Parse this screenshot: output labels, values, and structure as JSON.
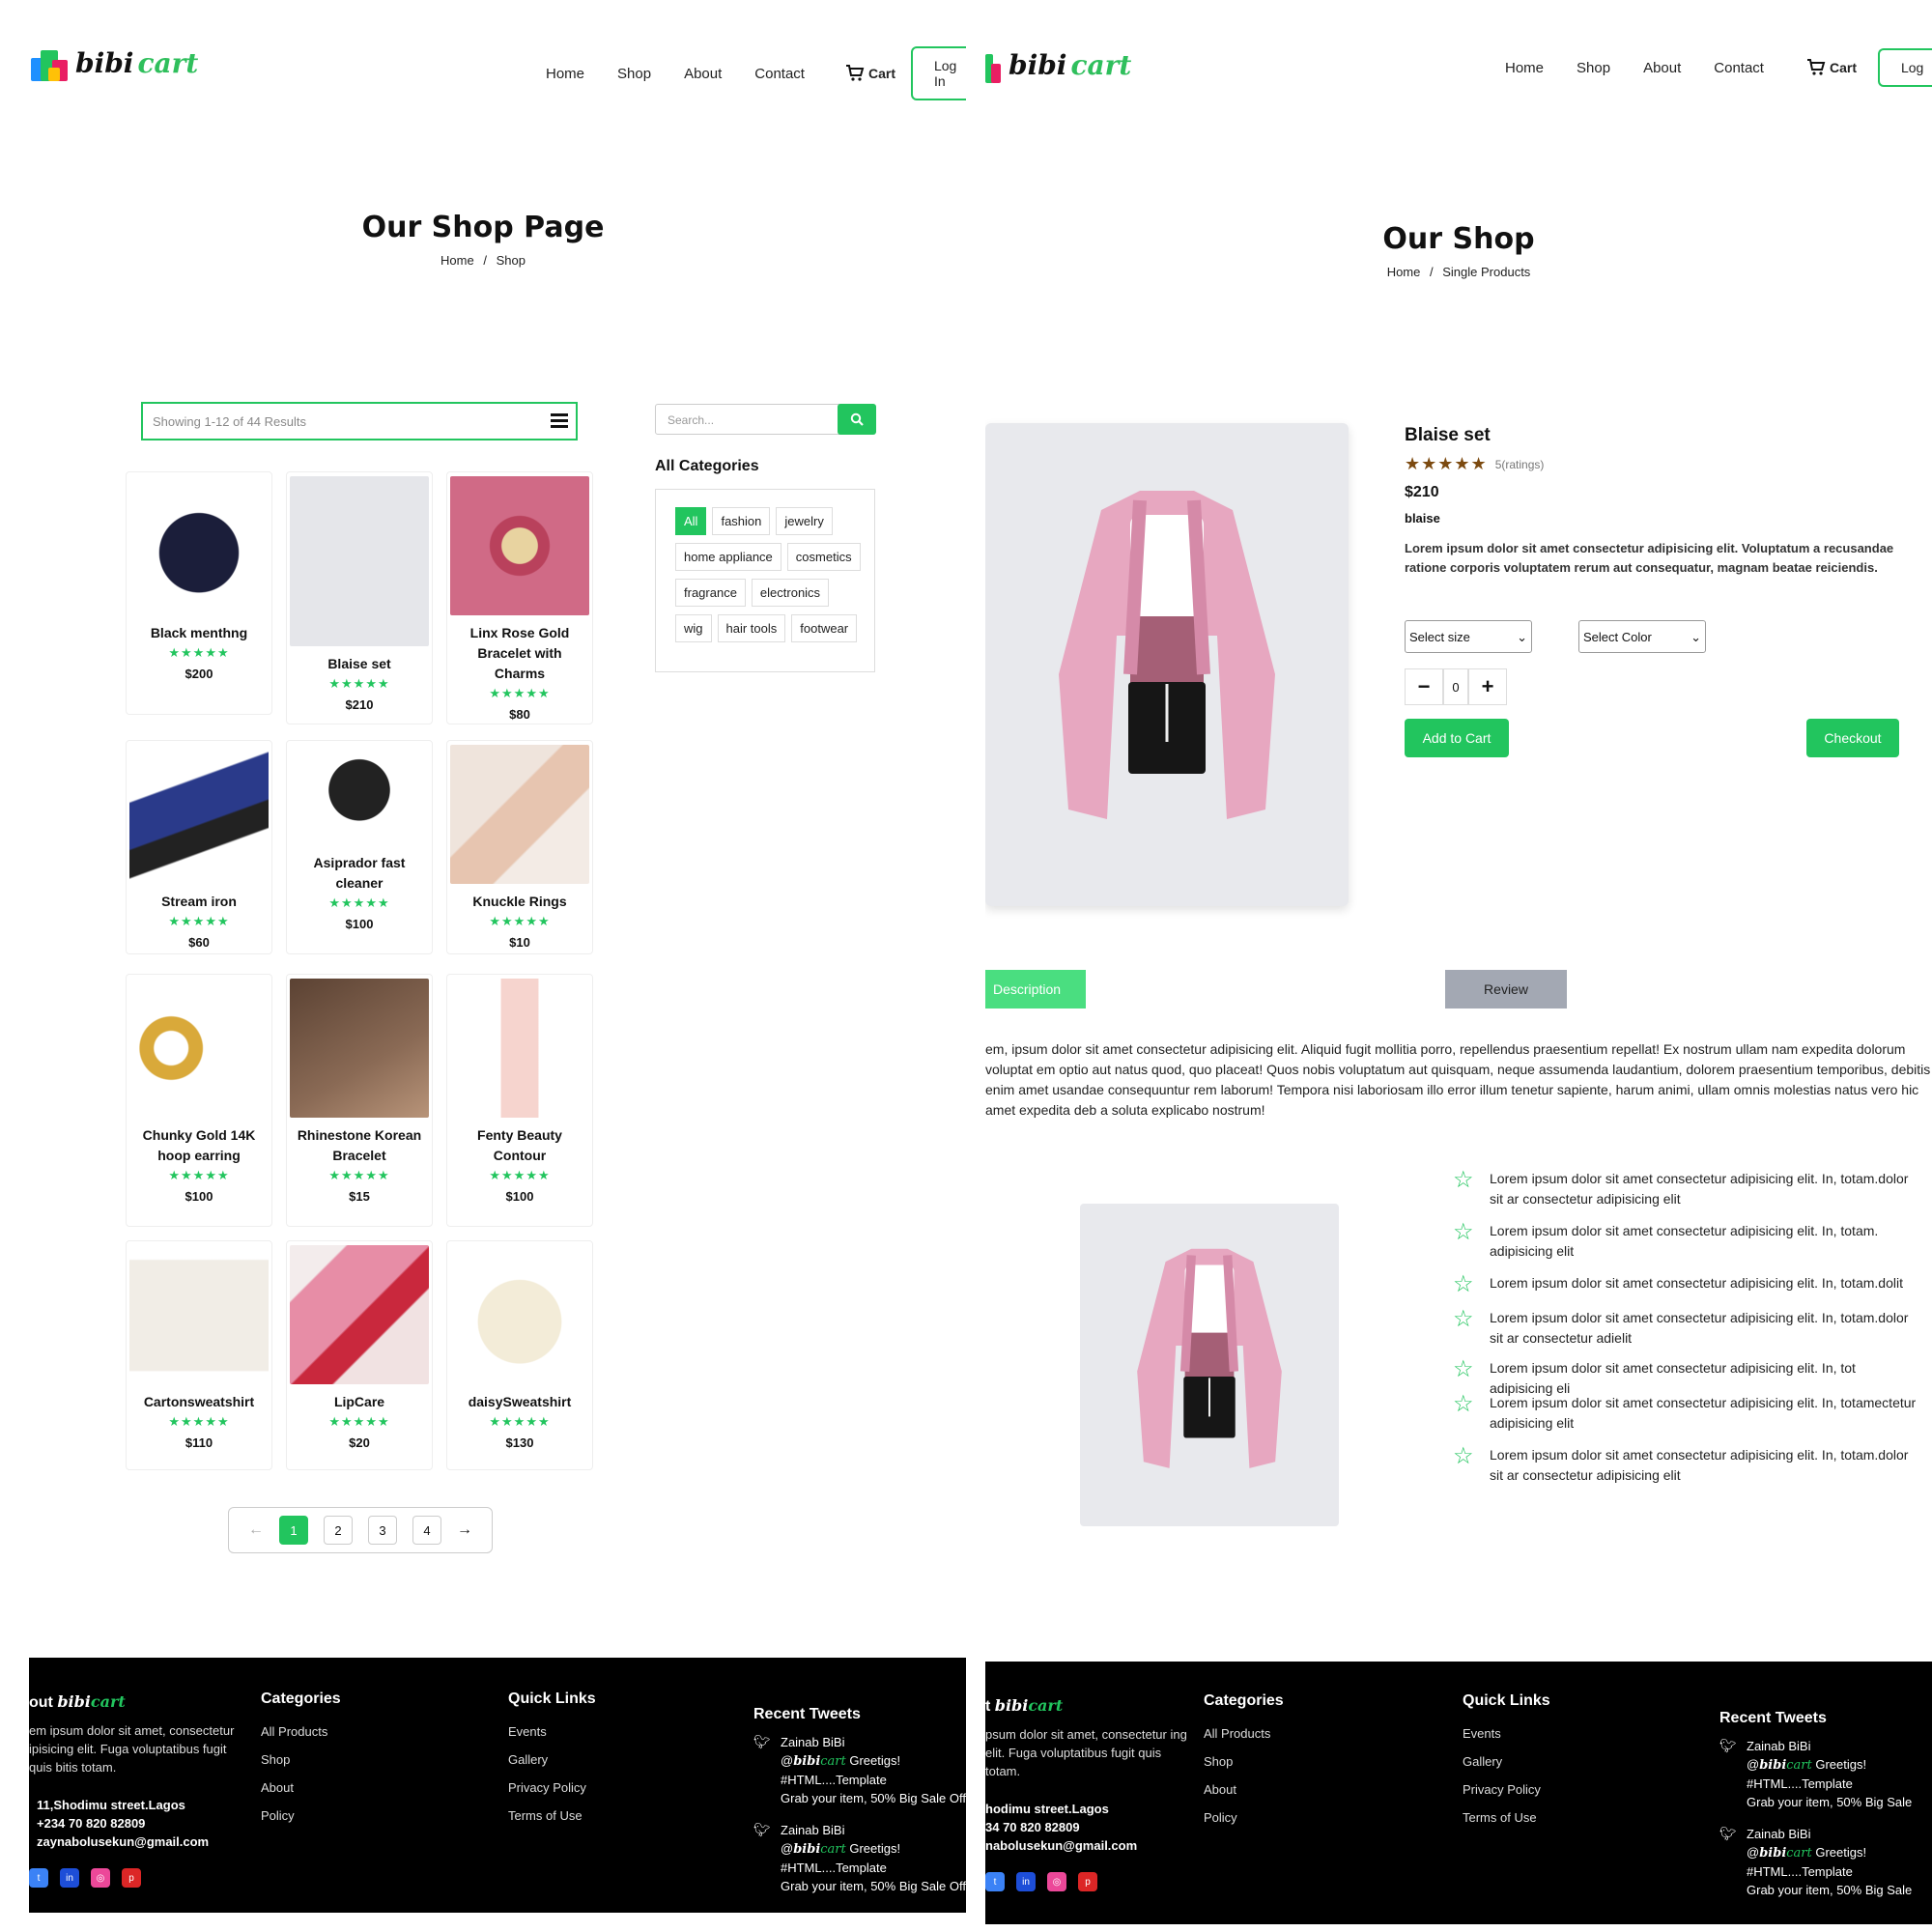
{
  "brand": {
    "w1": "bibi",
    "w2": "cart"
  },
  "nav": {
    "home": "Home",
    "shop": "Shop",
    "about": "About",
    "contact": "Contact",
    "cart": "Cart",
    "login_left": "Log In",
    "login_right": "Log"
  },
  "shop_page": {
    "title": "Our Shop Page",
    "crumb_home": "Home",
    "crumb_sep": "/",
    "crumb_cur": "Shop",
    "showing": "Showing 1-12 of 44 Results",
    "search_placeholder": "Search...",
    "categories_heading": "All Categories",
    "tags": [
      "All",
      "fashion",
      "jewelry",
      "home appliance",
      "cosmetics",
      "fragrance",
      "electronics",
      "wig",
      "hair tools",
      "footwear"
    ],
    "stars": "★★★★★",
    "products": [
      {
        "name": "Black menthng",
        "price": "$200"
      },
      {
        "name": "Blaise set",
        "price": "$210"
      },
      {
        "name": "Linx Rose Gold Bracelet with Charms",
        "price": "$80"
      },
      {
        "name": "Stream iron",
        "price": "$60"
      },
      {
        "name": "Asiprador fast cleaner",
        "price": "$100"
      },
      {
        "name": "Knuckle Rings",
        "price": "$10"
      },
      {
        "name": "Chunky Gold 14K hoop earring",
        "price": "$100"
      },
      {
        "name": "Rhinestone Korean Bracelet",
        "price": "$15"
      },
      {
        "name": "Fenty Beauty Contour",
        "price": "$100"
      },
      {
        "name": "Cartonsweatshirt",
        "price": "$110"
      },
      {
        "name": "LipCare",
        "price": "$20"
      },
      {
        "name": "daisySweatshirt",
        "price": "$130"
      }
    ],
    "pages": [
      "1",
      "2",
      "3",
      "4"
    ],
    "prev": "←",
    "next": "→"
  },
  "product_page": {
    "title": "Our Shop",
    "crumb_home": "Home",
    "crumb_sep": "/",
    "crumb_cur": "Single Products",
    "name": "Blaise set",
    "stars": "★★★★★",
    "ratings": "5(ratings)",
    "price": "$210",
    "brand": "blaise",
    "desc": "Lorem ipsum dolor sit amet consectetur adipisicing elit. Voluptatum a recusandae ratione corporis voluptatem rerum aut consequatur, magnam beatae reiciendis.",
    "size": "Select size",
    "color": "Select Color",
    "qty": "0",
    "minus": "−",
    "plus": "+",
    "add_to_cart": "Add to Cart",
    "checkout": "Checkout",
    "tab_description": "Description",
    "tab_review": "Review",
    "long_desc": "em, ipsum dolor sit amet consectetur adipisicing elit. Aliquid fugit mollitia porro, repellendus praesentium repellat! Ex nostrum ullam nam expedita dolorum voluptat em optio aut natus quod, quo placeat! Quos nobis voluptatum aut quisquam, neque assumenda laudantium, dolorem praesentium temporibus, debitis enim amet usandae consequuntur rem laborum! Tempora nisi laboriosam illo error illum tenetur sapiente, harum animi, ullam omnis molestias natus vero hic amet expedita deb a soluta explicabo nostrum!",
    "features": [
      "Lorem ipsum dolor sit amet consectetur adipisicing elit. In, totam.dolor sit ar consectetur adipisicing elit",
      "Lorem ipsum dolor sit amet consectetur adipisicing elit. In, totam. adipisicing elit",
      "Lorem ipsum dolor sit amet consectetur adipisicing elit. In, totam.dolit",
      "Lorem ipsum dolor sit amet consectetur adipisicing elit. In, totam.dolor sit ar consectetur adielit",
      "Lorem ipsum dolor sit amet consectetur adipisicing elit. In, tot adipisicing eli",
      "Lorem ipsum dolor sit amet consectetur adipisicing elit. In, totamectetur adipisicing elit",
      "Lorem ipsum dolor sit amet consectetur adipisicing elit. In, totam.dolor sit ar consectetur adipisicing elit"
    ]
  },
  "footer_left": {
    "about_pre": "out",
    "about_text": "em ipsum dolor sit amet, consectetur ipisicing elit. Fuga voluptatibus fugit quis bitis totam.",
    "address": "11,Shodimu street.Lagos",
    "phone": "+234 70 820 82809",
    "email": "zaynabolusekun@gmail.com",
    "categories_h": "Categories",
    "categories": [
      "All Products",
      "Shop",
      "About",
      "Policy"
    ],
    "quick_h": "Quick Links",
    "quick": [
      "Events",
      "Gallery",
      "Privacy Policy",
      "Terms of Use"
    ],
    "tweets_h": "Recent Tweets",
    "tweet_user": "Zainab BiBi",
    "tweet_at": "@",
    "tweet_tail": " Greetigs!",
    "tweet_tag": "#HTML....Template",
    "tweet_text": "Grab your item, 50% Big Sale Offe"
  },
  "footer_right": {
    "about_pre": "t",
    "about_text": "psum dolor sit amet, consectetur ing elit. Fuga voluptatibus fugit quis totam.",
    "address": "hodimu street.Lagos",
    "phone": "34 70 820 82809",
    "email": "nabolusekun@gmail.com",
    "categories_h": "Categories",
    "categories": [
      "All Products",
      "Shop",
      "About",
      "Policy"
    ],
    "quick_h": "Quick Links",
    "quick": [
      "Events",
      "Gallery",
      "Privacy Policy",
      "Terms of Use"
    ],
    "tweets_h": "Recent Tweets",
    "tweet_user": "Zainab BiBi",
    "tweet_at": "@",
    "tweet_tail": " Greetigs!",
    "tweet_tag": "#HTML....Template",
    "tweet_text": "Grab your item, 50% Big Sale"
  },
  "colors": {
    "accent": "#22c55e",
    "review_tab": "#a3a8b3",
    "product_bg": "#e8e9ed"
  },
  "icons": {
    "cart": "cart-icon",
    "search": "search-icon",
    "menu": "hamburger-icon",
    "star": "star-icon",
    "twitter": "twitter-icon"
  }
}
